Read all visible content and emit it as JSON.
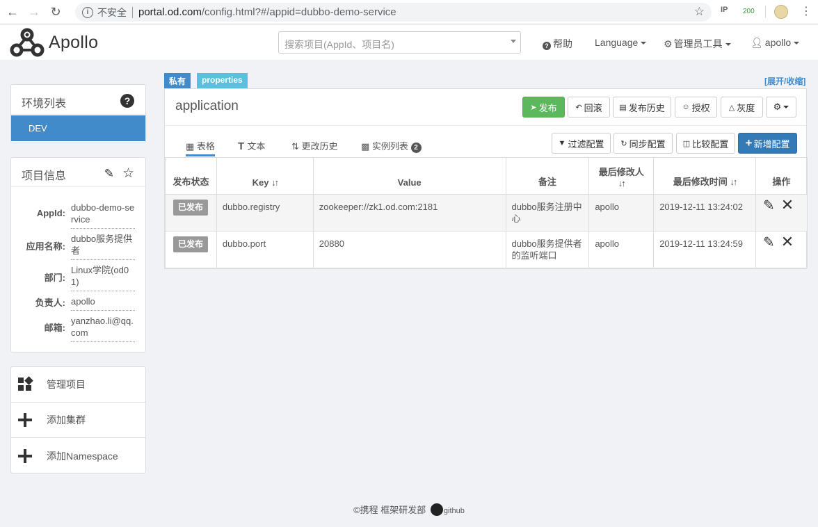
{
  "browser": {
    "insecure_label": "不安全",
    "url_host": "portal.od.com",
    "url_path": "/config.html?#/appid=dubbo-demo-service",
    "ext_ip": "IP",
    "ext_count": "200"
  },
  "navbar": {
    "logo_text": "Apollo",
    "search_placeholder": "搜索项目(AppId、项目名)",
    "help": "帮助",
    "language": "Language",
    "admin_tools": "管理员工具",
    "user": "apollo"
  },
  "env_panel": {
    "title": "环境列表",
    "envs": [
      "DEV"
    ]
  },
  "info_panel": {
    "title": "项目信息",
    "rows": [
      {
        "label": "AppId:",
        "value": "dubbo-demo-service"
      },
      {
        "label": "应用名称:",
        "value": "dubbo服务提供者"
      },
      {
        "label": "部门:",
        "value": "Linux学院(od01)"
      },
      {
        "label": "负责人:",
        "value": "apollo"
      },
      {
        "label": "邮箱:",
        "value": "yanzhao.li@qq.com"
      }
    ]
  },
  "actions": [
    {
      "label": "管理项目"
    },
    {
      "label": "添加集群"
    },
    {
      "label": "添加Namespace"
    }
  ],
  "namespace": {
    "tag_private": "私有",
    "tag_format": "properties",
    "expand_label": "[展开/收缩]",
    "title": "application",
    "buttons": {
      "release": "发布",
      "rollback": "回滚",
      "release_history": "发布历史",
      "grant": "授权",
      "gray": "灰度"
    },
    "tabs": {
      "table": "表格",
      "text": "文本",
      "history": "更改历史",
      "instances": "实例列表",
      "instances_count": "2"
    },
    "tools": {
      "filter": "过滤配置",
      "sync": "同步配置",
      "compare": "比较配置",
      "add": "新增配置"
    },
    "columns": {
      "status": "发布状态",
      "key": "Key",
      "value": "Value",
      "comment": "备注",
      "modifier": "最后修改人",
      "modified_time": "最后修改时间",
      "ops": "操作"
    },
    "rows": [
      {
        "status": "已发布",
        "key": "dubbo.registry",
        "value": "zookeeper://zk1.od.com:2181",
        "comment": "dubbo服务注册中心",
        "modifier": "apollo",
        "time": "2019-12-11 13:24:02"
      },
      {
        "status": "已发布",
        "key": "dubbo.port",
        "value": "20880",
        "comment": "dubbo服务提供者的监听端口",
        "modifier": "apollo",
        "time": "2019-12-11 13:24:59"
      }
    ]
  },
  "footer": {
    "copyright": "©携程 框架研发部",
    "github": "github"
  }
}
